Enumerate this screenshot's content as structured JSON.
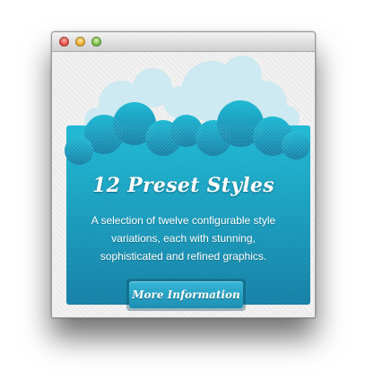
{
  "window": {
    "controls": [
      "close",
      "minimize",
      "zoom"
    ]
  },
  "card": {
    "title": "12 Preset Styles",
    "description": "A selection of twelve configurable style variations, each with stunning, sophisticated and refined graphics.",
    "button_label": "More Information"
  },
  "colors": {
    "accent": "#17a8c8",
    "accent_dark": "#137fa5",
    "cloud_light": "#cde9f1",
    "text": "#ffffff"
  },
  "icons": {
    "close": "close-icon",
    "minimize": "minimize-icon",
    "zoom": "zoom-icon"
  }
}
